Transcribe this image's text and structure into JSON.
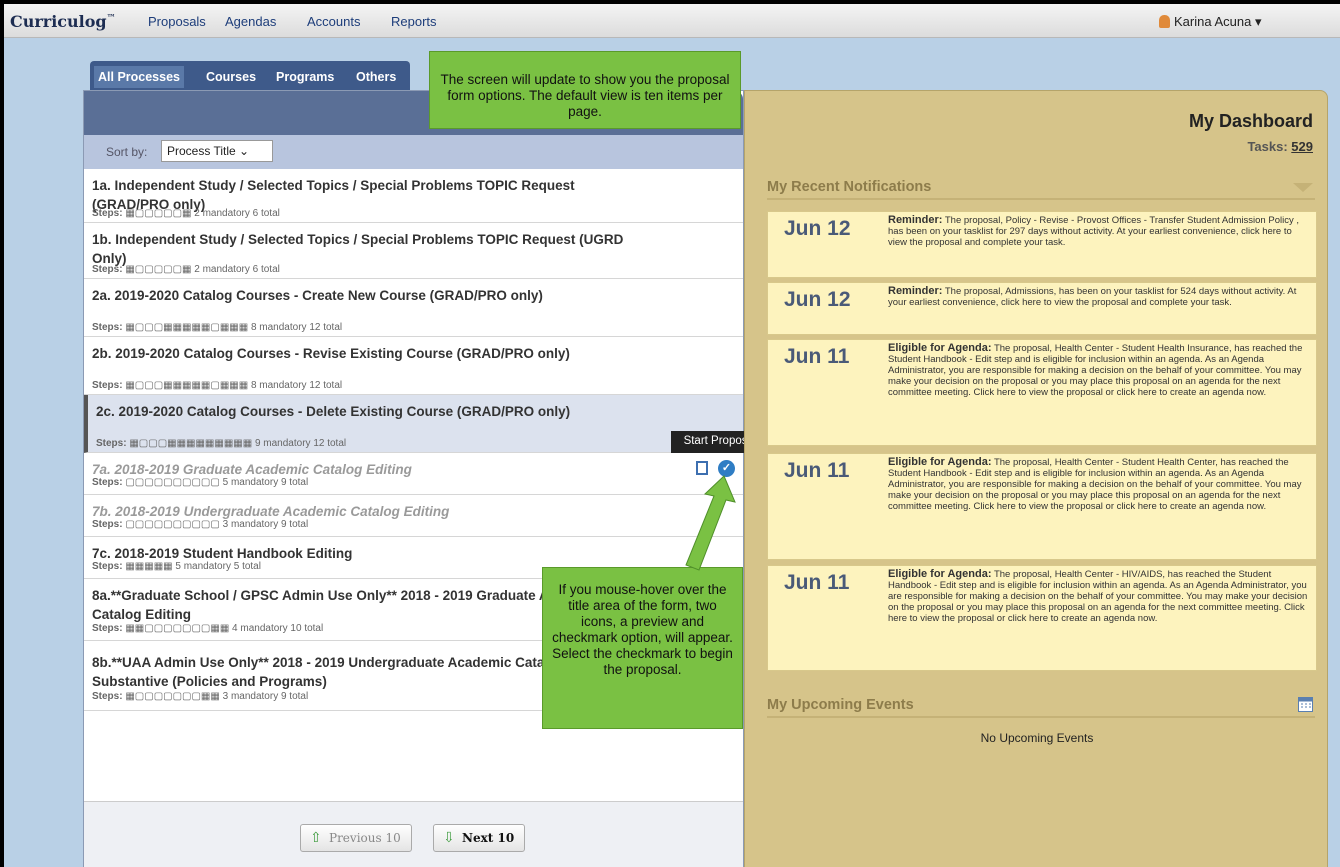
{
  "app": {
    "brand": "Curriculog",
    "tm": "™"
  },
  "nav": {
    "items": [
      "Proposals",
      "Agendas",
      "Accounts",
      "Reports"
    ],
    "user": "Karina Acuna ▾"
  },
  "tabs": [
    "All Processes",
    "Courses",
    "Programs",
    "Others"
  ],
  "sort": {
    "label": "Sort by:",
    "value": "Process Title  ⌄"
  },
  "processes": [
    {
      "title": "1a. Independent Study / Selected Topics / Special Problems TOPIC Request (GRAD/PRO only)",
      "steps_label": "Steps:",
      "steps": "▦▢▢▢▢▢▦ 2 mandatory 6 total"
    },
    {
      "title": "1b. Independent Study / Selected Topics / Special Problems TOPIC Request (UGRD Only)",
      "steps_label": "Steps:",
      "steps": "▦▢▢▢▢▢▦ 2 mandatory 6 total"
    },
    {
      "title": "2a. 2019-2020 Catalog Courses - Create New Course (GRAD/PRO only)",
      "steps_label": "Steps:",
      "steps": "▦▢▢▢▦▦▦▦▦▢▦▦▦ 8 mandatory 12 total"
    },
    {
      "title": "2b. 2019-2020 Catalog Courses - Revise Existing Course (GRAD/PRO only)",
      "steps_label": "Steps:",
      "steps": "▦▢▢▢▦▦▦▦▦▢▦▦▦ 8 mandatory 12 total"
    },
    {
      "title": "2c. 2019-2020 Catalog Courses - Delete Existing Course (GRAD/PRO only)",
      "steps_label": "Steps:",
      "steps": "▦▢▢▢▦▦▦▦▦▦▦▦▦ 9 mandatory 12 total"
    },
    {
      "title": "7a. 2018-2019 Graduate Academic Catalog Editing",
      "steps_label": "Steps:",
      "steps": "▢▢▢▢▢▢▢▢▢▢ 5 mandatory 9 total"
    },
    {
      "title": "7b. 2018-2019 Undergraduate Academic Catalog Editing",
      "steps_label": "Steps:",
      "steps": "▢▢▢▢▢▢▢▢▢▢ 3 mandatory 9 total"
    },
    {
      "title": "7c. 2018-2019 Student Handbook Editing",
      "steps_label": "Steps:",
      "steps": "▦▦▦▦▦ 5 mandatory 5 total"
    },
    {
      "title": "8a.**Graduate School / GPSC Admin Use Only** 2018 - 2019 Graduate Academic Catalog Editing",
      "steps_label": "Steps:",
      "steps": "▦▦▢▢▢▢▢▢▢▦▦ 4 mandatory 10 total"
    },
    {
      "title": "8b.**UAA Admin Use Only** 2018 - 2019 Undergraduate Academic Catalog - Approved Substantive (Policies and Programs)",
      "steps_label": "Steps:",
      "steps": "▦▢▢▢▢▢▢▢▦▦ 3 mandatory 9 total"
    }
  ],
  "pager": {
    "prev": "Previous 10",
    "next": "Next 10"
  },
  "dashboard": {
    "title": "My Dashboard",
    "tasks_label": "Tasks:",
    "tasks_count": "529"
  },
  "notifications_title": "My Recent Notifications",
  "notifications": [
    {
      "date": "Jun 12",
      "kind": "Reminder:",
      "text": "The proposal, Policy - Revise - Provost Offices - Transfer Student Admission Policy , has been on your tasklist for 297 days without activity. At your earliest convenience, click here to view the proposal and complete your task."
    },
    {
      "date": "Jun 12",
      "kind": "Reminder:",
      "text": "The proposal, Admissions, has been on your tasklist for 524 days without activity. At your earliest convenience, click here to view the proposal and complete your task."
    },
    {
      "date": "Jun 11",
      "kind": "Eligible for Agenda:",
      "text": "The proposal, Health Center - Student Health Insurance, has reached the Student Handbook - Edit step and is eligible for inclusion within an agenda. As an Agenda Administrator, you are responsible for making a decision on the behalf of your committee. You may make your decision on the proposal or you may place this proposal on an agenda for the next committee meeting. Click here to view the proposal or click here to create an agenda now."
    },
    {
      "date": "Jun 11",
      "kind": "Eligible for Agenda:",
      "text": "The proposal, Health Center - Student Health Center, has reached the Student Handbook - Edit step and is eligible for inclusion within an agenda. As an Agenda Administrator, you are responsible for making a decision on the behalf of your committee. You may make your decision on the proposal or you may place this proposal on an agenda for the next committee meeting. Click here to view the proposal or click here to create an agenda now."
    },
    {
      "date": "Jun 11",
      "kind": "Eligible for Agenda:",
      "text": "The proposal, Health Center - HIV/AIDS, has reached the Student Handbook - Edit step and is eligible for inclusion within an agenda. As an Agenda Administrator, you are responsible for making a decision on the behalf of your committee. You may make your decision on the proposal or you may place this proposal on an agenda for the next committee meeting. Click here to view the proposal or click here to create an agenda now."
    }
  ],
  "events_title": "My Upcoming Events",
  "events_empty": "No Upcoming Events",
  "tooltip": "Start Proposal",
  "callouts": {
    "top": "The screen will update to show you the proposal form options. The default view is ten items per page.",
    "bottom": "If you mouse-hover over the title area of the form, two icons, a preview and checkmark option, will appear. Select the checkmark to begin the proposal."
  },
  "colors": {
    "accent": "#7ac143",
    "dashboard": "#d6c48a",
    "nav_link": "#1d3d7a"
  }
}
